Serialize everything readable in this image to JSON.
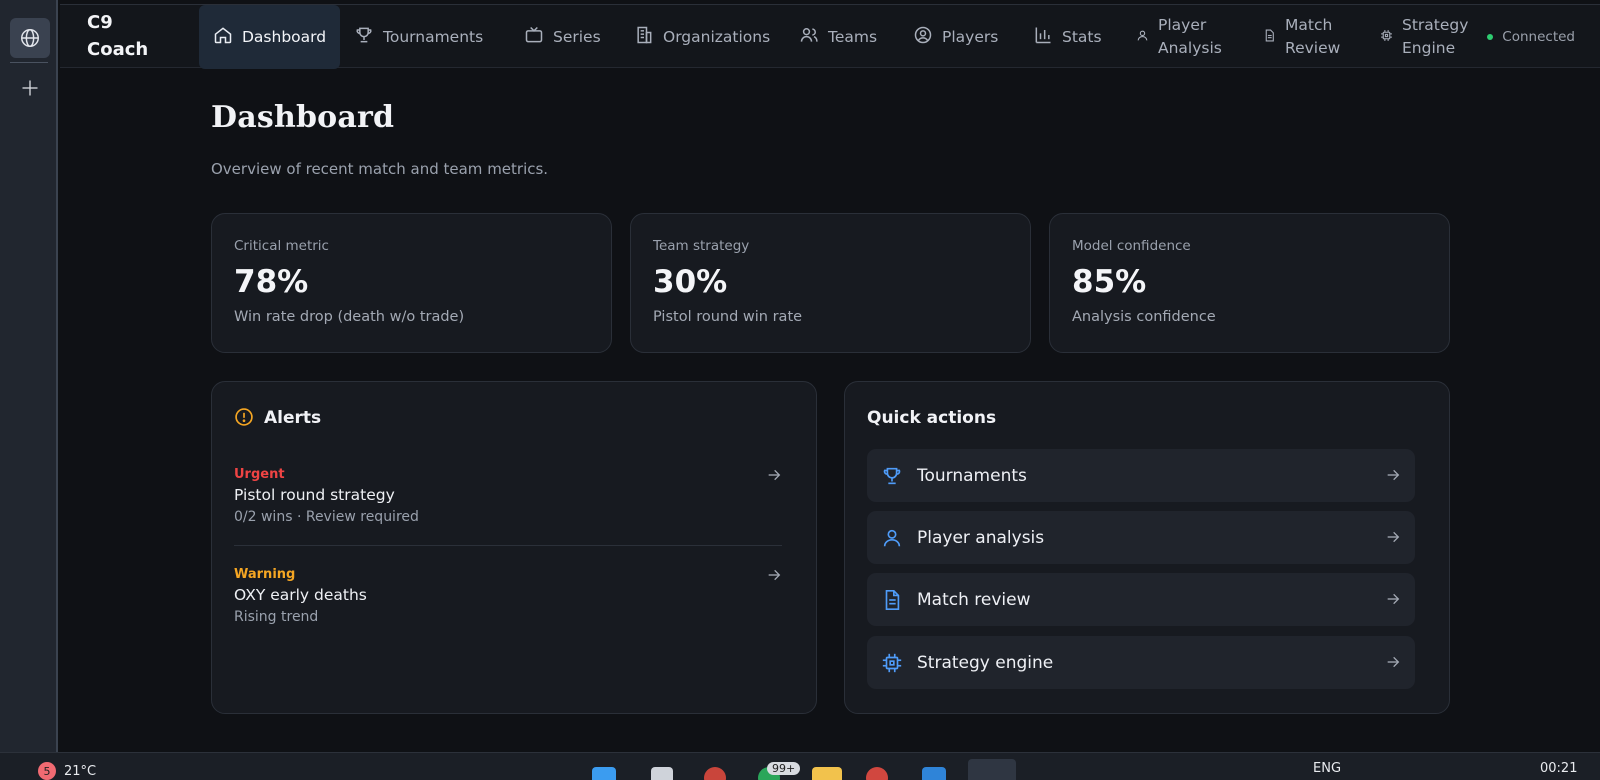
{
  "app": {
    "brand": "C9 Coach"
  },
  "nav": {
    "items": [
      {
        "label": "Dashboard",
        "icon": "home-icon"
      },
      {
        "label": "Tournaments",
        "icon": "trophy-icon"
      },
      {
        "label": "Series",
        "icon": "tv-icon"
      },
      {
        "label": "Organizations",
        "icon": "building-icon"
      },
      {
        "label": "Teams",
        "icon": "users-icon"
      },
      {
        "label": "Players",
        "icon": "user-circle-icon"
      },
      {
        "label": "Stats",
        "icon": "bar-chart-icon"
      },
      {
        "label": "Player Analysis",
        "icon": "user-icon"
      },
      {
        "label": "Match Review",
        "icon": "file-icon"
      },
      {
        "label": "Strategy Engine",
        "icon": "cpu-icon"
      }
    ],
    "status": "Connected",
    "status_color": "#2ecc71"
  },
  "page": {
    "title": "Dashboard",
    "subtitle": "Overview of recent match and team metrics."
  },
  "metrics": [
    {
      "label": "Critical metric",
      "value": "78%",
      "desc": "Win rate drop (death w/o trade)"
    },
    {
      "label": "Team strategy",
      "value": "30%",
      "desc": "Pistol round win rate"
    },
    {
      "label": "Model confidence",
      "value": "85%",
      "desc": "Analysis confidence"
    }
  ],
  "alerts": {
    "title": "Alerts",
    "icon": "alert-circle-icon",
    "items": [
      {
        "severity": "Urgent",
        "color": "#ef4444",
        "title": "Pistol round strategy",
        "meta": "0/2 wins · Review required"
      },
      {
        "severity": "Warning",
        "color": "#f5a623",
        "title": "OXY early deaths",
        "meta": "Rising trend"
      }
    ]
  },
  "quick_actions": {
    "title": "Quick actions",
    "items": [
      {
        "label": "Tournaments",
        "icon": "trophy-icon"
      },
      {
        "label": "Player analysis",
        "icon": "user-icon"
      },
      {
        "label": "Match review",
        "icon": "file-text-icon"
      },
      {
        "label": "Strategy engine",
        "icon": "cpu-icon"
      }
    ],
    "accent": "#4f9cf9"
  },
  "taskbar": {
    "weather_badge": "5",
    "temperature": "21°C",
    "language": "ENG",
    "time": "00:21",
    "notification_count": "99+"
  }
}
